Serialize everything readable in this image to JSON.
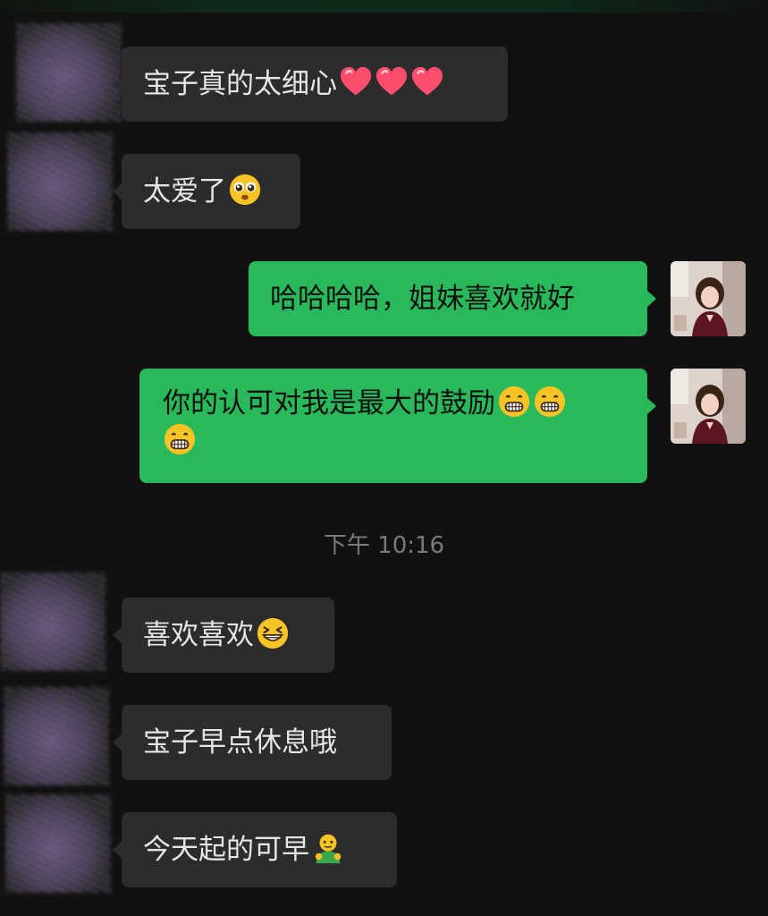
{
  "chat": {
    "messages": [
      {
        "side": "in",
        "text": "宝子真的太细心",
        "emojis": [
          "heart",
          "heart",
          "heart"
        ]
      },
      {
        "side": "in",
        "text": "太爱了",
        "emojis": [
          "pleading-face"
        ]
      },
      {
        "side": "out",
        "text": "哈哈哈哈，姐妹喜欢就好",
        "emojis": []
      },
      {
        "side": "out",
        "text": "你的认可对我是最大的鼓励",
        "emojis": [
          "grinning-face",
          "grinning-face",
          "grinning-face"
        ]
      },
      {
        "side": "in",
        "text": "喜欢喜欢",
        "emojis": [
          "grinning-squinting-face"
        ]
      },
      {
        "side": "in",
        "text": "宝子早点休息哦",
        "emojis": []
      },
      {
        "side": "in",
        "text": "今天起的可早",
        "emojis": [
          "person-bowing"
        ]
      }
    ],
    "timestamp": "下午 10:16"
  },
  "colors": {
    "background": "#111111",
    "incoming_bubble": "#2c2c2c",
    "outgoing_bubble": "#29b95a",
    "incoming_text": "#e6e6e6",
    "outgoing_text": "#101010",
    "timestamp_text": "#7a7a7a"
  }
}
